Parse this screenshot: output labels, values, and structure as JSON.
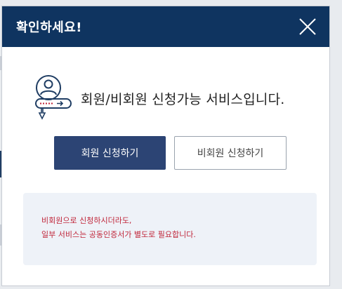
{
  "modal": {
    "title": "확인하세요!",
    "close_icon": "close-icon",
    "hero_icon": "member-card-icon",
    "message": "회원/비회원 신청가능 서비스입니다.",
    "buttons": {
      "member_label": "회원 신청하기",
      "guest_label": "비회원 신청하기"
    },
    "notice": {
      "line1": "비회원으로 신청하시더라도,",
      "line2": "일부 서비스는 공동인증서가 별도로 필요합니다."
    }
  },
  "colors": {
    "header_bg": "#0f3460",
    "primary_button": "#2c4474",
    "notice_bg": "#eef2f8",
    "notice_text": "#c0263a"
  }
}
